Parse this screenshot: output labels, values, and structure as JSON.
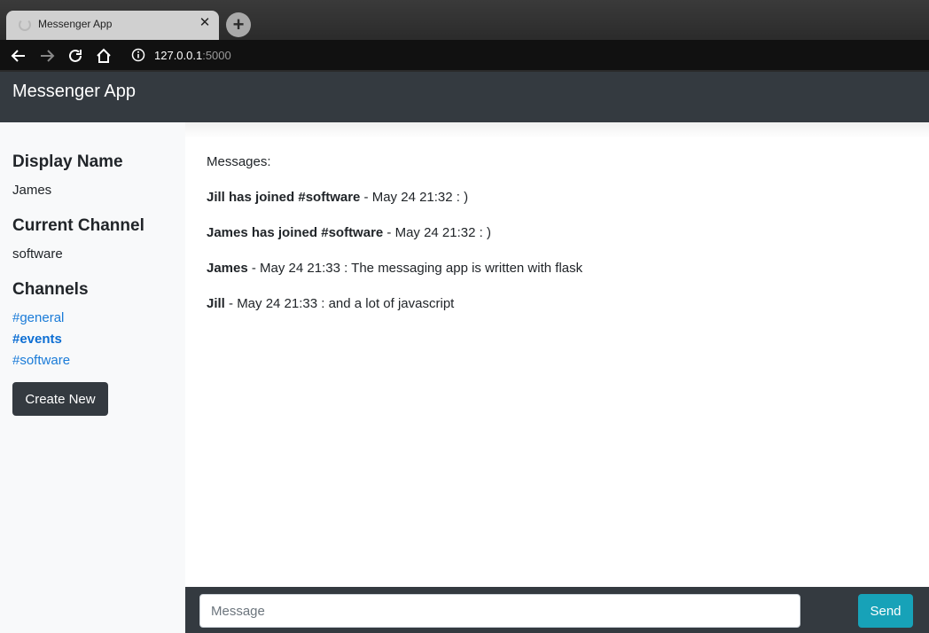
{
  "browser": {
    "tab_title": "Messenger App",
    "address_host": "127.0.0.1",
    "address_port": ":5000"
  },
  "navbar": {
    "brand": "Messenger App"
  },
  "sidebar": {
    "display_name_heading": "Display Name",
    "display_name": "James",
    "current_channel_heading": "Current Channel",
    "current_channel": "software",
    "channels_heading": "Channels",
    "channels": [
      {
        "label": "#general"
      },
      {
        "label": "#events"
      },
      {
        "label": "#software"
      }
    ],
    "create_button": "Create New"
  },
  "messages": {
    "label": "Messages:",
    "items": [
      {
        "sender": "Jill has joined #software",
        "meta": " - May 24 21:32 : )"
      },
      {
        "sender": "James has joined #software",
        "meta": " - May 24 21:32 : )"
      },
      {
        "sender": "James",
        "meta": " - May 24 21:33 : The messaging app is written with flask"
      },
      {
        "sender": "Jill",
        "meta": " - May 24 21:33 : and a lot of javascript"
      }
    ]
  },
  "composer": {
    "placeholder": "Message",
    "send_label": "Send"
  },
  "colors": {
    "navbar": "#343a40",
    "sidebar": "#f8f9fa",
    "link": "#1a7bd8",
    "send_button": "#17a2b8"
  }
}
